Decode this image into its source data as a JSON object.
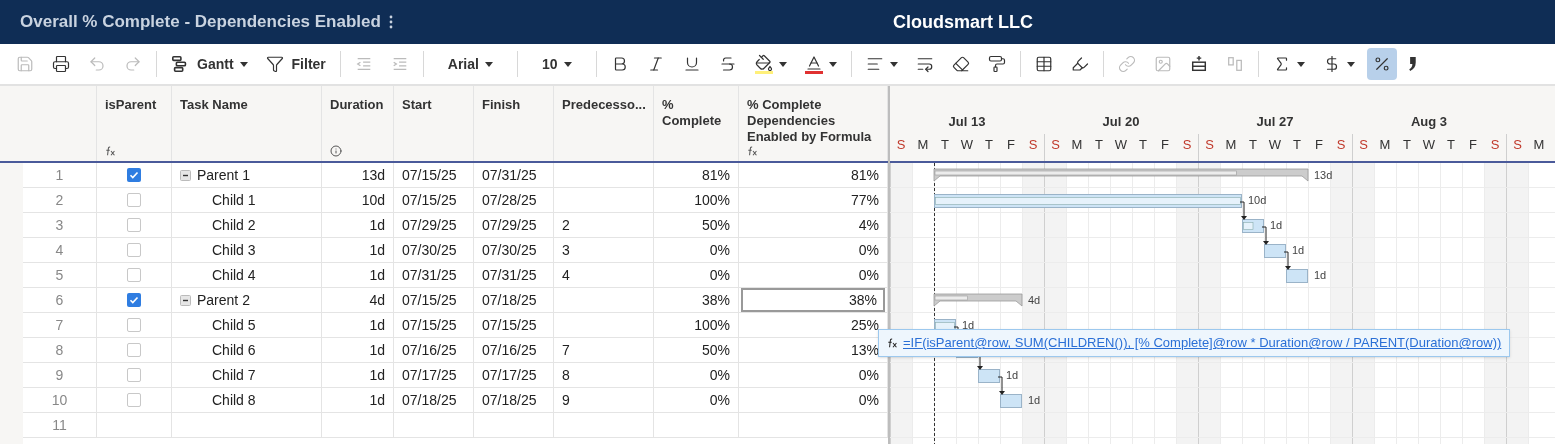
{
  "title_bar": {
    "title": "Overall % Complete - Dependencies Enabled",
    "company": "Cloudsmart LLC"
  },
  "toolbar": [
    [
      {
        "kind": "save",
        "disabled": true
      },
      {
        "kind": "print",
        "disabled": false
      },
      {
        "kind": "undo",
        "disabled": true
      },
      {
        "kind": "redo",
        "disabled": true
      }
    ],
    [
      {
        "kind": "gantt",
        "label": "Gantt",
        "caret": true,
        "disabled": false
      },
      {
        "kind": "filter",
        "label": "Filter",
        "disabled": false
      }
    ],
    [
      {
        "kind": "outdent",
        "disabled": true
      },
      {
        "kind": "indent",
        "disabled": true
      }
    ],
    [
      {
        "kind": "font",
        "label": "Arial",
        "caret": true,
        "disabled": false
      }
    ],
    [
      {
        "kind": "size",
        "label": "10",
        "caret": true,
        "disabled": false
      }
    ],
    [
      {
        "kind": "bold",
        "disabled": false
      },
      {
        "kind": "italic",
        "disabled": false
      },
      {
        "kind": "underline",
        "disabled": false
      },
      {
        "kind": "strike",
        "disabled": false
      },
      {
        "kind": "fill",
        "caret": true,
        "disabled": false
      },
      {
        "kind": "textcolor",
        "caret": true,
        "disabled": false
      }
    ],
    [
      {
        "kind": "align",
        "caret": true,
        "disabled": false
      },
      {
        "kind": "wrap",
        "disabled": false
      },
      {
        "kind": "eraser",
        "disabled": false
      },
      {
        "kind": "roller",
        "disabled": false
      }
    ],
    [
      {
        "kind": "table",
        "disabled": false
      },
      {
        "kind": "highlight",
        "disabled": false
      }
    ],
    [
      {
        "kind": "link",
        "disabled": true
      },
      {
        "kind": "image",
        "disabled": true
      },
      {
        "kind": "insert",
        "disabled": false
      },
      {
        "kind": "columns",
        "disabled": true
      }
    ],
    [
      {
        "kind": "sigma",
        "caret": true,
        "disabled": false
      },
      {
        "kind": "dollar",
        "caret": true,
        "disabled": false
      },
      {
        "kind": "percent",
        "disabled": false,
        "selected": true
      },
      {
        "kind": "comma",
        "disabled": false
      }
    ]
  ],
  "columns": [
    {
      "label": "isParent",
      "kind": "formula"
    },
    {
      "label": "Task Name",
      "kind": "plain"
    },
    {
      "label": "Duration",
      "kind": "info"
    },
    {
      "label": "Start",
      "kind": "plain"
    },
    {
      "label": "Finish",
      "kind": "plain"
    },
    {
      "label": "Predecesso...",
      "kind": "plain"
    },
    {
      "label": "% Complete",
      "kind": "plain"
    },
    {
      "label": "% Complete Dependencies Enabled by Formula",
      "kind": "formula"
    }
  ],
  "rows": [
    {
      "num": "1",
      "checked": true,
      "expanded": true,
      "name": "Parent 1",
      "duration": "13d",
      "start": "07/15/25",
      "finish": "07/31/25",
      "pct": "81%",
      "pct_dep": "81%",
      "bar_label": "13d",
      "level": 0.81,
      "selected": false,
      "children": [
        {
          "num": "2",
          "checked": false,
          "name": "Child 1",
          "duration": "10d",
          "start": "07/15/25",
          "finish": "07/28/25",
          "pct": "100%",
          "pct_dep": "77%",
          "bar_label": "10d",
          "level": 1,
          "selected": false
        },
        {
          "num": "3",
          "checked": false,
          "name": "Child 2",
          "duration": "1d",
          "start": "07/29/25",
          "finish": "07/29/25",
          "predecessors": "2",
          "pct": "50%",
          "pct_dep": "4%",
          "bar_label": "1d",
          "level": 0.5,
          "selected": false
        },
        {
          "num": "4",
          "checked": false,
          "name": "Child 3",
          "duration": "1d",
          "start": "07/30/25",
          "finish": "07/30/25",
          "predecessors": "3",
          "pct": "0%",
          "pct_dep": "0%",
          "bar_label": "1d",
          "selected": false
        },
        {
          "num": "5",
          "checked": false,
          "name": "Child 4",
          "duration": "1d",
          "start": "07/31/25",
          "finish": "07/31/25",
          "predecessors": "4",
          "pct": "0%",
          "pct_dep": "0%",
          "bar_label": "1d",
          "selected": false
        }
      ]
    },
    {
      "num": "6",
      "checked": true,
      "expanded": true,
      "name": "Parent 2",
      "duration": "4d",
      "start": "07/15/25",
      "finish": "07/18/25",
      "pct": "38%",
      "pct_dep": "38%",
      "bar_label": "4d",
      "level": 0.38,
      "selected": true,
      "children": [
        {
          "num": "7",
          "checked": false,
          "name": "Child 5",
          "duration": "1d",
          "start": "07/15/25",
          "finish": "07/15/25",
          "pct": "100%",
          "pct_dep": "25%",
          "bar_label": "1d",
          "level": 1,
          "selected": false
        },
        {
          "num": "8",
          "checked": false,
          "name": "Child 6",
          "duration": "1d",
          "start": "07/16/25",
          "finish": "07/16/25",
          "predecessors": "7",
          "pct": "50%",
          "pct_dep": "13%",
          "selected": false
        },
        {
          "num": "9",
          "checked": false,
          "name": "Child 7",
          "duration": "1d",
          "start": "07/17/25",
          "finish": "07/17/25",
          "predecessors": "8",
          "pct": "0%",
          "pct_dep": "0%",
          "bar_label": "1d",
          "selected": false
        },
        {
          "num": "10",
          "checked": false,
          "name": "Child 8",
          "duration": "1d",
          "start": "07/18/25",
          "finish": "07/18/25",
          "predecessors": "9",
          "pct": "0%",
          "pct_dep": "0%",
          "bar_label": "1d",
          "selected": false
        }
      ]
    }
  ],
  "empty_rows": [
    {
      "num": "11"
    }
  ],
  "timeline": {
    "weeks": [
      {
        "label": "Jul 13"
      },
      {
        "label": "Jul 20"
      },
      {
        "label": "Jul 27"
      },
      {
        "label": "Aug 3"
      }
    ],
    "days": [
      {
        "letter": "S",
        "weekend": true
      },
      {
        "letter": "M",
        "weekend": false
      },
      {
        "letter": "T",
        "weekend": false
      },
      {
        "letter": "W",
        "weekend": false
      },
      {
        "letter": "T",
        "weekend": false
      },
      {
        "letter": "F",
        "weekend": false
      },
      {
        "letter": "S",
        "weekend": true
      },
      {
        "letter": "S",
        "weekend": true
      },
      {
        "letter": "M",
        "weekend": false
      },
      {
        "letter": "T",
        "weekend": false
      },
      {
        "letter": "W",
        "weekend": false
      },
      {
        "letter": "T",
        "weekend": false
      },
      {
        "letter": "F",
        "weekend": false
      },
      {
        "letter": "S",
        "weekend": true
      },
      {
        "letter": "S",
        "weekend": true
      },
      {
        "letter": "M",
        "weekend": false
      },
      {
        "letter": "T",
        "weekend": false
      },
      {
        "letter": "W",
        "weekend": false
      },
      {
        "letter": "T",
        "weekend": false
      },
      {
        "letter": "F",
        "weekend": false
      },
      {
        "letter": "S",
        "weekend": true
      },
      {
        "letter": "S",
        "weekend": true
      },
      {
        "letter": "M",
        "weekend": false
      },
      {
        "letter": "T",
        "weekend": false
      },
      {
        "letter": "W",
        "weekend": false
      },
      {
        "letter": "T",
        "weekend": false
      },
      {
        "letter": "F",
        "weekend": false
      },
      {
        "letter": "S",
        "weekend": true
      },
      {
        "letter": "S",
        "weekend": true
      },
      {
        "letter": "M",
        "weekend": false
      }
    ]
  },
  "formula_tooltip": {
    "formula": "=IF(isParent@row, SUM(CHILDREN()), [% Complete]@row * Duration@row / PARENT(Duration@row))"
  }
}
